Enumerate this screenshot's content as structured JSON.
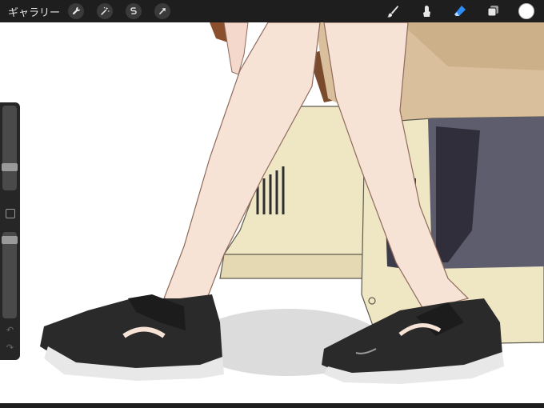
{
  "app": {
    "gallery_label": "ギャラリー"
  },
  "toolbar": {
    "left_tools": [
      {
        "name": "actions",
        "icon": "wrench-icon"
      },
      {
        "name": "adjustments",
        "icon": "magic-wand-icon"
      },
      {
        "name": "selection",
        "icon": "selection-s-icon"
      },
      {
        "name": "transform",
        "icon": "transform-arrow-icon"
      }
    ],
    "right_tools": [
      {
        "name": "brush",
        "icon": "brush-icon"
      },
      {
        "name": "smudge",
        "icon": "smudge-icon"
      },
      {
        "name": "eraser",
        "icon": "eraser-icon",
        "active_color": "#2f8bf5"
      },
      {
        "name": "layers",
        "icon": "layers-icon"
      }
    ],
    "current_color": "#ffffff"
  },
  "sidebar": {
    "brush_size_level": 0.25,
    "opacity_level": 0.95,
    "modify_icon": "square-modify-icon",
    "undo_icon": "undo-arrow-icon",
    "redo_icon": "redo-arrow-icon"
  },
  "colors": {
    "toolbar_bg": "#1e1e1e",
    "sidebar_bg": "#262626",
    "skin": "#f7e2d6",
    "shorts": "#d9bf9b",
    "monitor": "#efe6c4",
    "shoe": "#2a2a2a",
    "sole": "#e8e8e8"
  }
}
